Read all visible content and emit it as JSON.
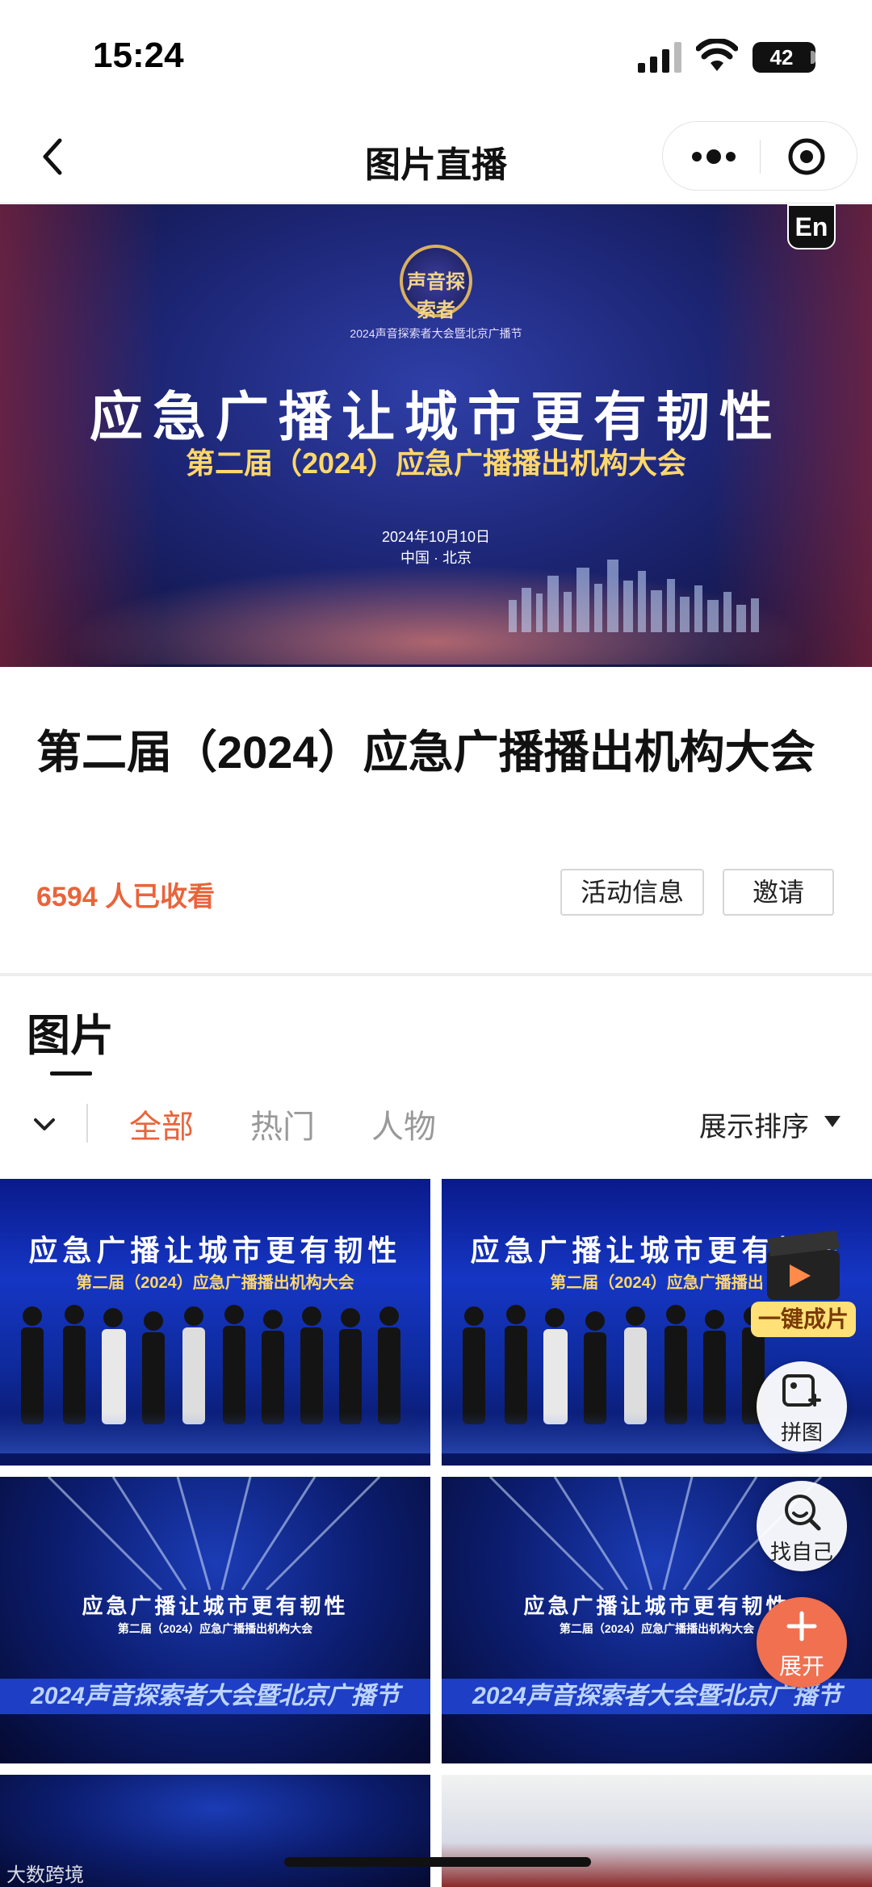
{
  "status_bar": {
    "time": "15:24",
    "battery": "42",
    "battery_level": 0.42,
    "icons": [
      "signal-icon",
      "wifi-icon",
      "battery-icon"
    ]
  },
  "nav": {
    "title": "图片直播",
    "icons": [
      "back-icon",
      "more-icon",
      "close-miniprogram-icon"
    ]
  },
  "banner": {
    "logo_text": "声音探索者",
    "small_line": "2024声音探索者大会暨北京广播节",
    "headline": "应急广播让城市更有韧性",
    "subtitle": "第二届（2024）应急广播播出机构大会",
    "date": "2024年10月10日",
    "place": "中国 · 北京",
    "lang_badge": "En"
  },
  "event": {
    "title": "第二届（2024）应急广播播出机构大会",
    "viewers": "6594 人已收看",
    "info_button": "活动信息",
    "invite_button": "邀请"
  },
  "photos": {
    "section_title": "图片",
    "tabs": [
      "全部",
      "热门",
      "人物"
    ],
    "active_tab": "全部",
    "sort_label": "展示排序",
    "grid": [
      {
        "headline": "应急广播让城市更有韧性",
        "subtitle": "第二届（2024）应急广播播出机构大会"
      },
      {
        "headline": "应急广播让城市更有韧性",
        "subtitle": "第二届（2024）应急广播播出"
      },
      {
        "headline": "应急广播让城市更有韧性",
        "subtitle": "第二届（2024）应急广播播出机构大会",
        "band": "2024声音探索者大会暨北京广播节"
      },
      {
        "headline": "应急广播让城市更有韧性",
        "subtitle": "第二届（2024）应急广播播出机构大会",
        "band": "2024声音探索者大会暨北京广播节"
      }
    ]
  },
  "floating": {
    "movie_label": "一键成片",
    "collage_label": "拼图",
    "find_label": "找自己",
    "expand_label": "展开"
  },
  "watermark": "大数跨境",
  "colors": {
    "accent": "#e9643b",
    "fab_expand": "#f07050",
    "banner_bg": "#1d2676"
  }
}
